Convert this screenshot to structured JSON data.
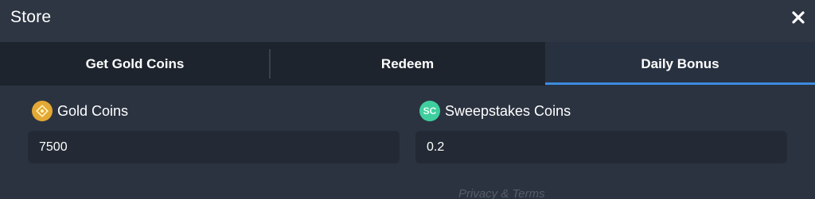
{
  "header": {
    "title": "Store",
    "close_icon": "close-icon"
  },
  "tabs": [
    {
      "label": "Get Gold Coins",
      "active": false
    },
    {
      "label": "Redeem",
      "active": false
    },
    {
      "label": "Daily Bonus",
      "active": true
    }
  ],
  "balances": {
    "gold": {
      "label": "Gold Coins",
      "value": "7500",
      "icon": "gold-coin-icon"
    },
    "sweepstakes": {
      "label": "Sweepstakes Coins",
      "value": "0.2",
      "icon": "sc",
      "icon_text": "SC"
    }
  },
  "footer": {
    "link": "Privacy & Terms"
  },
  "colors": {
    "background": "#2b3340",
    "tab_bar": "#1e242e",
    "active_tab_indicator": "#3d8be0",
    "gold": "#e3a934",
    "sweepstakes": "#3fcf9e"
  }
}
